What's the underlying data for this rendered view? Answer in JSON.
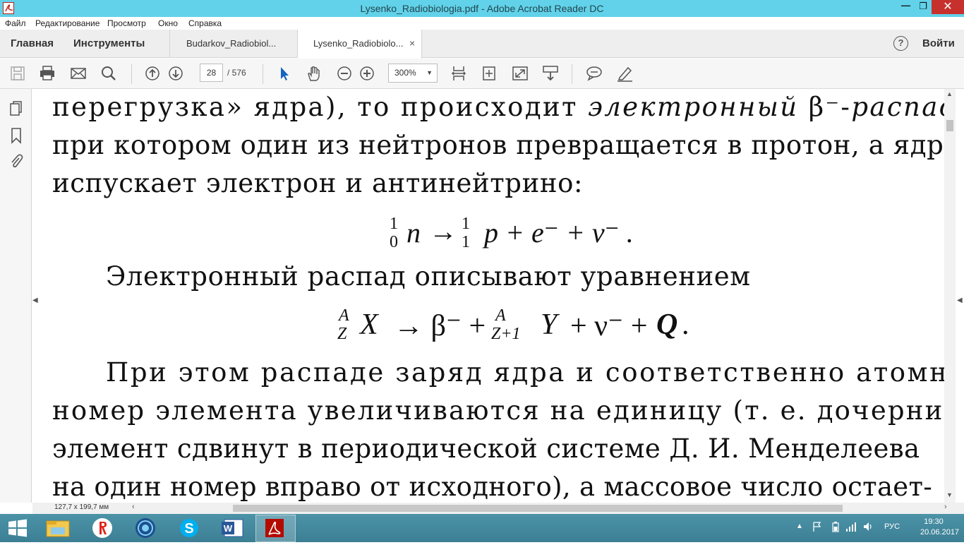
{
  "window": {
    "title": "Lysenko_Radiobiologia.pdf - Adobe Acrobat Reader DC",
    "minimize": "—",
    "maximize": "❐",
    "close": "✕"
  },
  "menu": [
    "Файл",
    "Редактирование",
    "Просмотр",
    "Окно",
    "Справка"
  ],
  "nav": {
    "home": "Главная",
    "tools": "Инструменты",
    "sign_in": "Войти",
    "help_icon": "?"
  },
  "tabs": [
    {
      "label": "Budarkov_Radiobiol..."
    },
    {
      "label": "Lysenko_Radiobiolo...",
      "close": "×"
    }
  ],
  "toolbar": {
    "page_current": "28",
    "page_total": "/  576",
    "zoom": "300%"
  },
  "document": {
    "lines": [
      "перегрузка» ядра), то происходит электронный β⁻-распад,",
      "при котором один из нейтронов превращается в протон, а ядро",
      "испускает электрон и антинейтрино:",
      "Электронный распад описывают уравнением",
      "При этом распаде заряд ядра и соответственно атомный",
      "номер элемента увеличиваются на единицу (т. е. дочерний",
      "элемент сдвинут в периодической системе Д. И. Менделеева",
      "на один номер вправо от исходного), а массовое число остает-"
    ],
    "line1_prefix": "перегрузка» ядра), то происходит ",
    "line1_italic": "электронный",
    "line1_beta": " β⁻-",
    "line1_italic2": "распад,",
    "formula1": {
      "n_top": "1",
      "n_bot": "0",
      "n": "n",
      "arrow": "→",
      "p_top": "1",
      "p_bot": "1",
      "p": "p",
      "rest": "+ e⁻ + ν⁻ ."
    },
    "formula2": {
      "x_top": "A",
      "x_bot": "Z",
      "x": "X",
      "mid": "→ β⁻ +",
      "y_top": "A",
      "y_bot": "Z+1",
      "y": "Y",
      "rest": "+ ν⁻ + ",
      "q": "Q",
      "end": "."
    }
  },
  "status": {
    "dimensions": "127,7 x 199,7 мм"
  },
  "taskbar": {
    "lang": "РУС",
    "time": "19:30",
    "date": "20.06.2017"
  }
}
